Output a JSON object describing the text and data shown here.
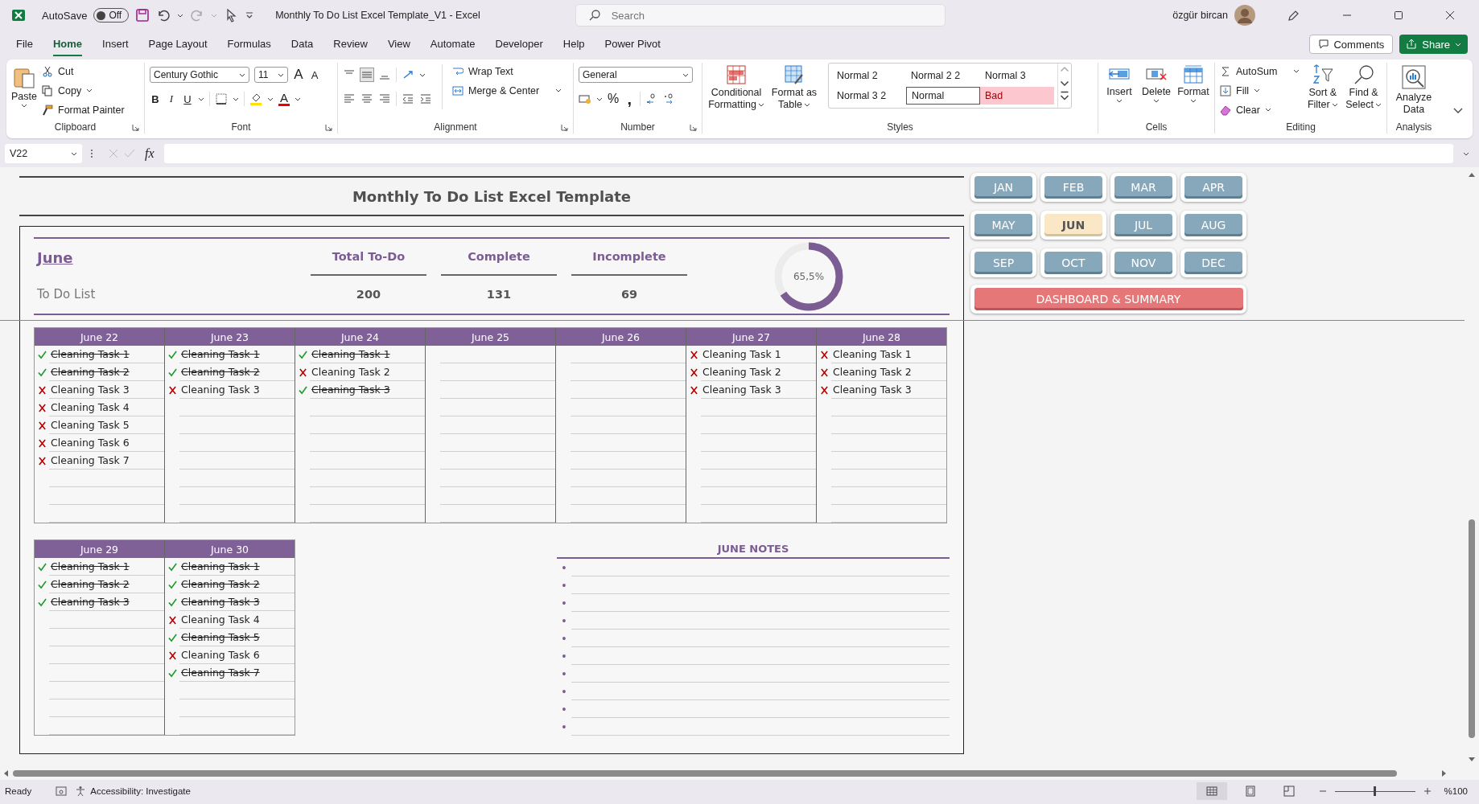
{
  "title_bar": {
    "autosave_label": "AutoSave",
    "autosave_on": false,
    "autosave_text": "Off",
    "document_title": "Monthly To Do List Excel Template_V1  -  Excel",
    "search_placeholder": "Search",
    "user_name": "özgür bircan"
  },
  "menu_tabs": [
    {
      "label": "File",
      "selected": false
    },
    {
      "label": "Home",
      "selected": true
    },
    {
      "label": "Insert",
      "selected": false
    },
    {
      "label": "Page Layout",
      "selected": false
    },
    {
      "label": "Formulas",
      "selected": false
    },
    {
      "label": "Data",
      "selected": false
    },
    {
      "label": "Review",
      "selected": false
    },
    {
      "label": "View",
      "selected": false
    },
    {
      "label": "Automate",
      "selected": false
    },
    {
      "label": "Developer",
      "selected": false
    },
    {
      "label": "Help",
      "selected": false
    },
    {
      "label": "Power Pivot",
      "selected": false
    }
  ],
  "comments": "Comments",
  "share": "Share",
  "ribbon": {
    "clipboard": {
      "paste": "Paste",
      "cut": "Cut",
      "copy": "Copy",
      "format_painter": "Format Painter",
      "label": "Clipboard"
    },
    "font": {
      "family": "Century Gothic",
      "size": "11",
      "grow": "A",
      "shrink": "A",
      "bold": "B",
      "italic": "I",
      "underline": "U",
      "font_color": "A",
      "label": "Font"
    },
    "alignment": {
      "wrap": "Wrap Text",
      "merge": "Merge & Center",
      "label": "Alignment"
    },
    "number": {
      "format": "General",
      "percent": "%",
      "comma": ",",
      "label": "Number"
    },
    "styles": {
      "conditional": [
        "Conditional",
        "Formatting"
      ],
      "format_table": [
        "Format as",
        "Table"
      ],
      "gallery": [
        {
          "label": "Normal 2",
          "kind": "plain"
        },
        {
          "label": "Normal 2 2",
          "kind": "plain"
        },
        {
          "label": "Normal 3",
          "kind": "plain"
        },
        {
          "label": "Normal 3 2",
          "kind": "plain"
        },
        {
          "label": "Normal",
          "kind": "current"
        },
        {
          "label": "Bad",
          "kind": "bad"
        }
      ],
      "label": "Styles"
    },
    "cells": {
      "insert": "Insert",
      "delete": "Delete",
      "format": "Format",
      "label": "Cells"
    },
    "editing": {
      "autosum": "AutoSum",
      "fill": "Fill",
      "clear": "Clear",
      "sort": [
        "Sort &",
        "Filter"
      ],
      "find": [
        "Find &",
        "Select"
      ],
      "label": "Editing"
    },
    "analysis": {
      "analyze": [
        "Analyze",
        "Data"
      ],
      "label": "Analysis"
    }
  },
  "formula_bar": {
    "name_box": "V22",
    "fx": "fx"
  },
  "sheet": {
    "title": "Monthly To Do List Excel Template",
    "month": "June",
    "subtitle": "To Do List",
    "stats": [
      {
        "label": "Total To-Do",
        "value": "200"
      },
      {
        "label": "Complete",
        "value": "131"
      },
      {
        "label": "Incomplete",
        "value": "69"
      }
    ],
    "donut": {
      "label": "65,5%",
      "level": 0.655
    },
    "week_1": [
      {
        "date": "June 22",
        "tasks": [
          {
            "text": "Cleaning Task 1",
            "done": true
          },
          {
            "text": "Cleaning Task 2",
            "done": true
          },
          {
            "text": "Cleaning Task 3",
            "done": false
          },
          {
            "text": "Cleaning Task 4",
            "done": false
          },
          {
            "text": "Cleaning Task 5",
            "done": false
          },
          {
            "text": "Cleaning Task 6",
            "done": false
          },
          {
            "text": "Cleaning Task 7",
            "done": false
          }
        ]
      },
      {
        "date": "June 23",
        "tasks": [
          {
            "text": "Cleaning Task 1",
            "done": true
          },
          {
            "text": "Cleaning Task 2",
            "done": true
          },
          {
            "text": "Cleaning Task 3",
            "done": false
          }
        ]
      },
      {
        "date": "June 24",
        "tasks": [
          {
            "text": "Cleaning Task 1",
            "done": true
          },
          {
            "text": "Cleaning Task 2",
            "done": false
          },
          {
            "text": "Cleaning Task 3",
            "done": true
          }
        ]
      },
      {
        "date": "June 25"
      },
      {
        "date": "June 26"
      },
      {
        "date": "June 27",
        "tasks": [
          {
            "text": "Cleaning Task 1",
            "done": false
          },
          {
            "text": "Cleaning Task 2",
            "done": false
          },
          {
            "text": "Cleaning Task 3",
            "done": false
          }
        ]
      },
      {
        "date": "June 28",
        "tasks": [
          {
            "text": "Cleaning Task 1",
            "done": false
          },
          {
            "text": "Cleaning Task 2",
            "done": false
          },
          {
            "text": "Cleaning Task 3",
            "done": false
          }
        ]
      }
    ],
    "week_2": [
      {
        "date": "June 29",
        "tasks": [
          {
            "text": "Cleaning Task 1",
            "done": true
          },
          {
            "text": "Cleaning Task 2",
            "done": true
          },
          {
            "text": "Cleaning Task 3",
            "done": true
          }
        ]
      },
      {
        "date": "June 30",
        "tasks": [
          {
            "text": "Cleaning Task 1",
            "done": true
          },
          {
            "text": "Cleaning Task 2",
            "done": true
          },
          {
            "text": "Cleaning Task 3",
            "done": true
          },
          {
            "text": "Cleaning Task 4",
            "done": false
          },
          {
            "text": "Cleaning Task 5",
            "done": true
          },
          {
            "text": "Cleaning Task 6",
            "done": false
          },
          {
            "text": "Cleaning Task 7",
            "done": true
          }
        ]
      }
    ],
    "notes": {
      "title": "JUNE NOTES",
      "bullets": [
        "•",
        "•",
        "•",
        "•",
        "•",
        "•",
        "•",
        "•",
        "•",
        "•"
      ]
    }
  },
  "months": [
    {
      "label": "JAN",
      "selected": false
    },
    {
      "label": "FEB",
      "selected": false
    },
    {
      "label": "MAR",
      "selected": false
    },
    {
      "label": "APR",
      "selected": false
    },
    {
      "label": "MAY",
      "selected": false
    },
    {
      "label": "JUN",
      "selected": true
    },
    {
      "label": "JUL",
      "selected": false
    },
    {
      "label": "AUG",
      "selected": false
    },
    {
      "label": "SEP",
      "selected": false
    },
    {
      "label": "OCT",
      "selected": false
    },
    {
      "label": "NOV",
      "selected": false
    },
    {
      "label": "DEC",
      "selected": false
    }
  ],
  "dashboard_button": "DASHBOARD & SUMMARY",
  "status_bar": {
    "ready": "Ready",
    "accessibility": "Accessibility: Investigate",
    "zoom": "%100",
    "zoom_slider": {
      "level": 0.5
    }
  }
}
